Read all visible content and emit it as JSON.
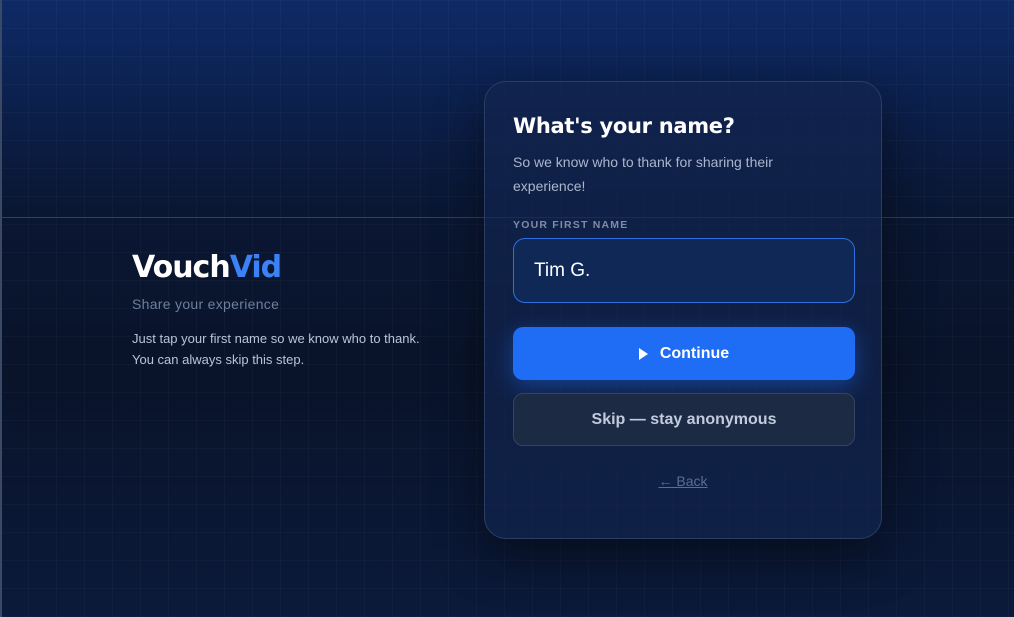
{
  "brand": {
    "logo_part1": "Vouch",
    "logo_part2": "Vid",
    "tagline": "Share your experience",
    "description": "Just tap your first name so we know who to thank. You can always skip this step."
  },
  "card": {
    "title": "What's your name?",
    "subtitle": "So we know who to thank for sharing their experience!",
    "field_label": "YOUR FIRST NAME",
    "name_value": "Tim G.",
    "continue_label": "Continue",
    "continue_icon": "play-icon",
    "skip_label": "Skip — stay anonymous",
    "back_label": "← Back"
  },
  "colors": {
    "accent": "#1f6cf5",
    "logo_accent": "#3b82f6"
  }
}
